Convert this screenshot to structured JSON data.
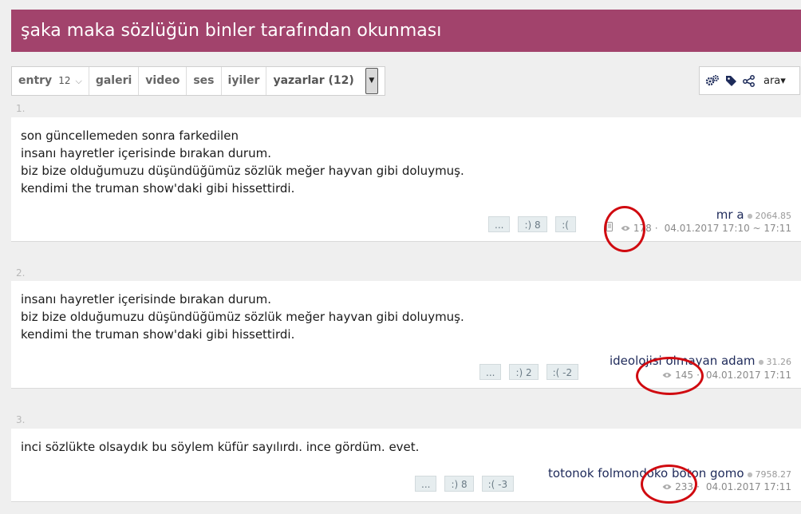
{
  "page": {
    "title": "şaka maka sözlüğün binler tarafından okunması"
  },
  "toolbar": {
    "entry_label": "entry",
    "entry_count": "12",
    "tabs": [
      "galeri",
      "video",
      "ses",
      "iyiler"
    ],
    "authors_label": "yazarlar (12)",
    "search_label": "ara"
  },
  "entries": [
    {
      "number": "1.",
      "lines": [
        "son güncellemeden sonra farkedilen",
        "insanı hayretler içerisinde bırakan durum.",
        "biz bize olduğumuzu düşündüğümüz sözlük meğer hayvan gibi doluymuş.",
        "kendimi the truman show'daki gibi hissettirdi."
      ],
      "votes": [
        "...",
        ":) 8",
        ":("
      ],
      "author": "mr a",
      "karma": "2064.85",
      "views": "178",
      "date": "04.01.2017 17:10 ~ 17:11"
    },
    {
      "number": "2.",
      "lines": [
        "insanı hayretler içerisinde bırakan durum.",
        "biz bize olduğumuzu düşündüğümüz sözlük meğer hayvan gibi doluymuş.",
        "kendimi the truman show'daki gibi hissettirdi."
      ],
      "votes": [
        "...",
        ":) 2",
        ":( -2"
      ],
      "author": "ideolojisi olmayan adam",
      "karma": "31.26",
      "views": "145",
      "date": "04.01.2017 17:11"
    },
    {
      "number": "3.",
      "lines": [
        "inci sözlükte olsaydık bu söylem küfür sayılırdı. ince gördüm. evet."
      ],
      "votes": [
        "...",
        ":) 8",
        ":( -3"
      ],
      "author": "totonok folmondoko boton gomo",
      "karma": "7958.27",
      "views": "233",
      "date": "04.01.2017 17:11"
    }
  ],
  "colors": {
    "header": "#a2436c",
    "annotation": "#d00a10",
    "author": "#1e2a5a"
  }
}
